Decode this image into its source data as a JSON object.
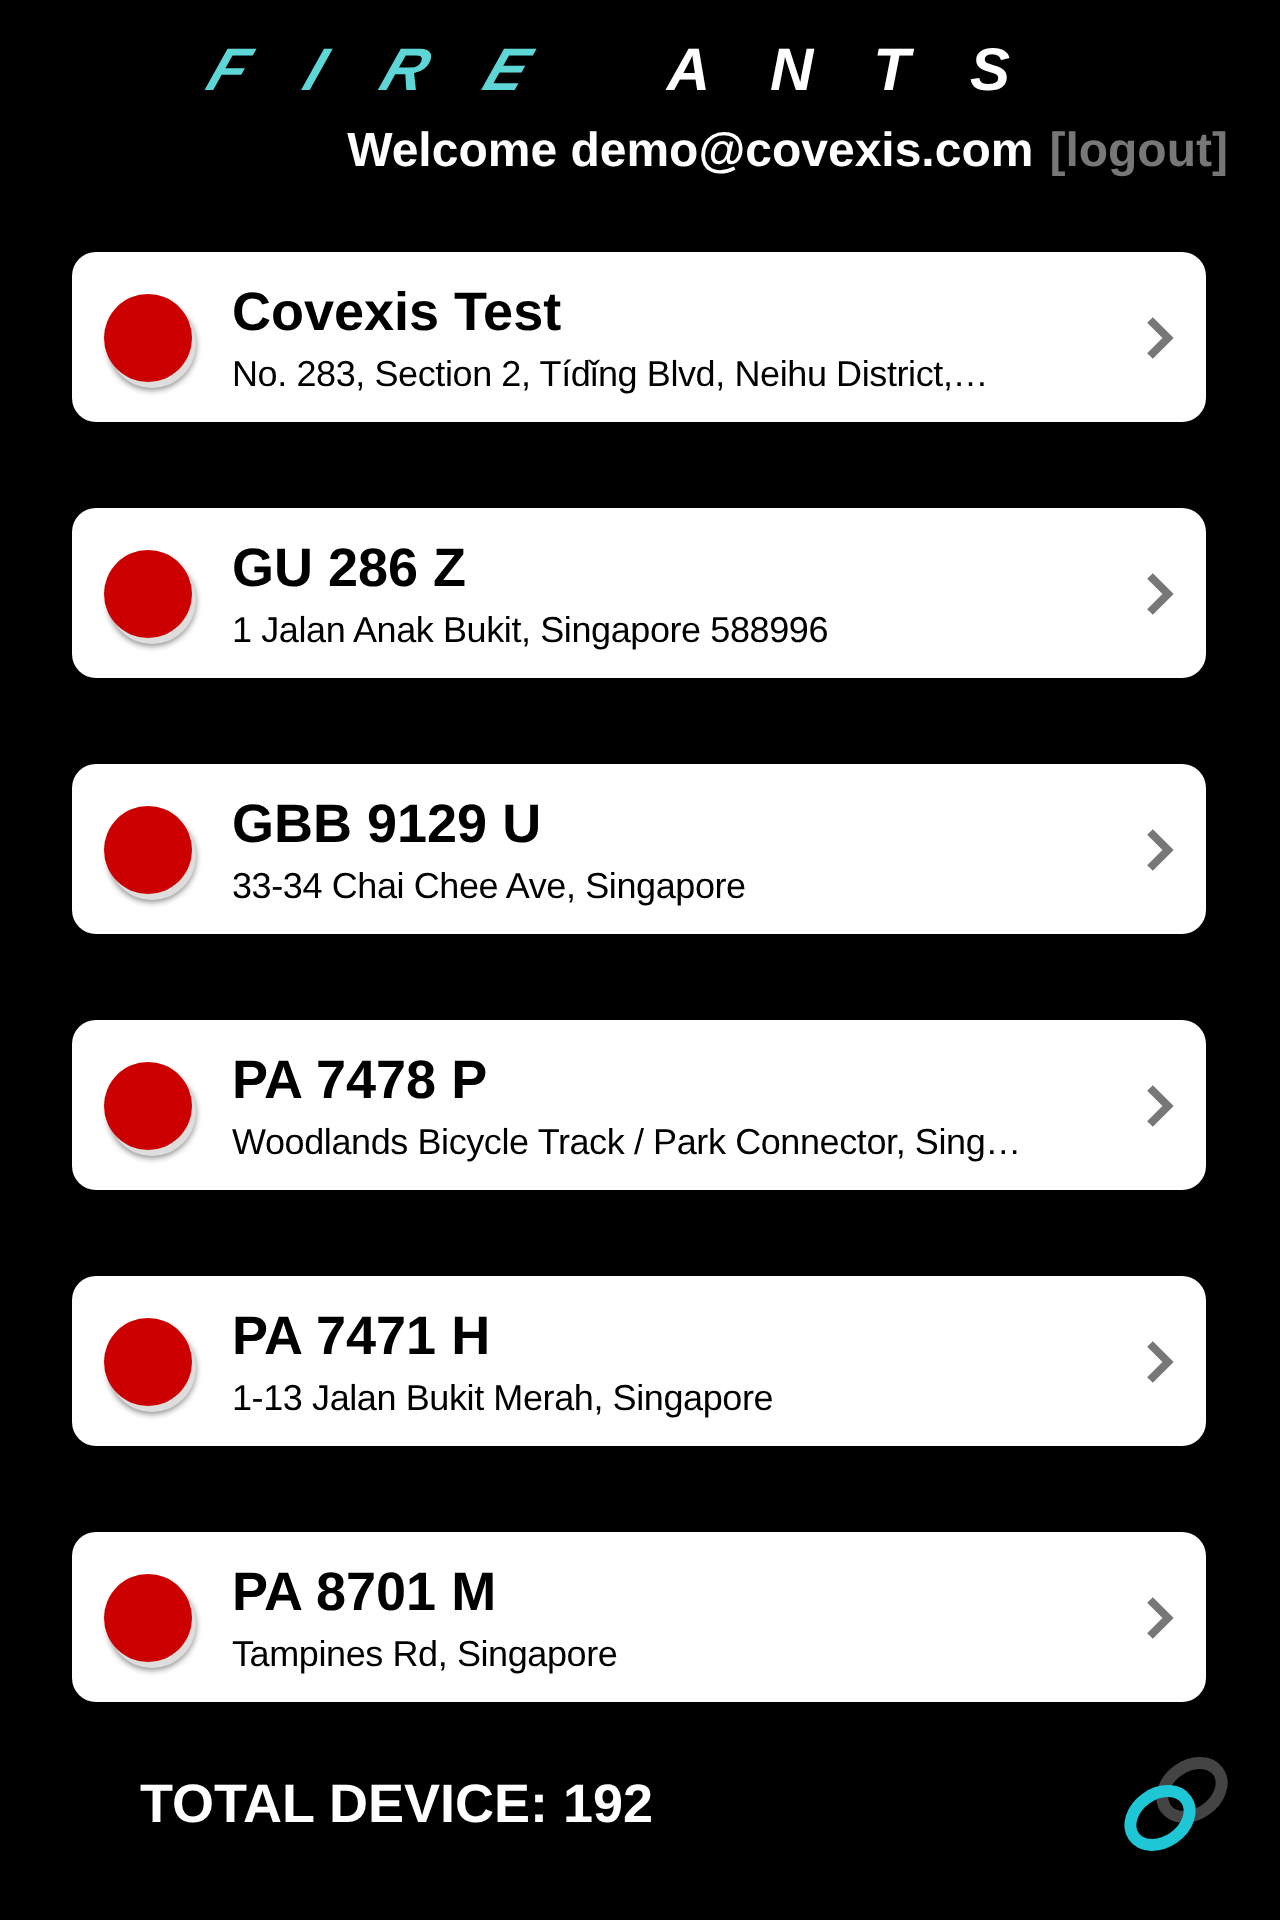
{
  "logo": {
    "part_1": "FIRE",
    "part_2": "ANTS"
  },
  "welcome": {
    "text": "Welcome demo@covexis.com",
    "logout": "[logout]"
  },
  "devices": [
    {
      "name": "Covexis Test",
      "address": "No. 283, Section 2, Tídǐng Blvd, Neihu District,…",
      "color": "#cc0000"
    },
    {
      "name": "GU 286 Z",
      "address": "1 Jalan Anak Bukit, Singapore 588996",
      "color": "#cc0000"
    },
    {
      "name": "GBB 9129 U",
      "address": "33-34 Chai Chee Ave, Singapore",
      "color": "#cc0000"
    },
    {
      "name": "PA 7478 P",
      "address": "Woodlands Bicycle Track / Park Connector, Sing…",
      "color": "#cc0000"
    },
    {
      "name": "PA 7471 H",
      "address": "1-13 Jalan Bukit Merah, Singapore",
      "color": "#cc0000"
    },
    {
      "name": "PA 8701 M",
      "address": "Tampines Rd, Singapore",
      "color": "#cc0000"
    }
  ],
  "footer": {
    "total": "TOTAL DEVICE: 192"
  }
}
